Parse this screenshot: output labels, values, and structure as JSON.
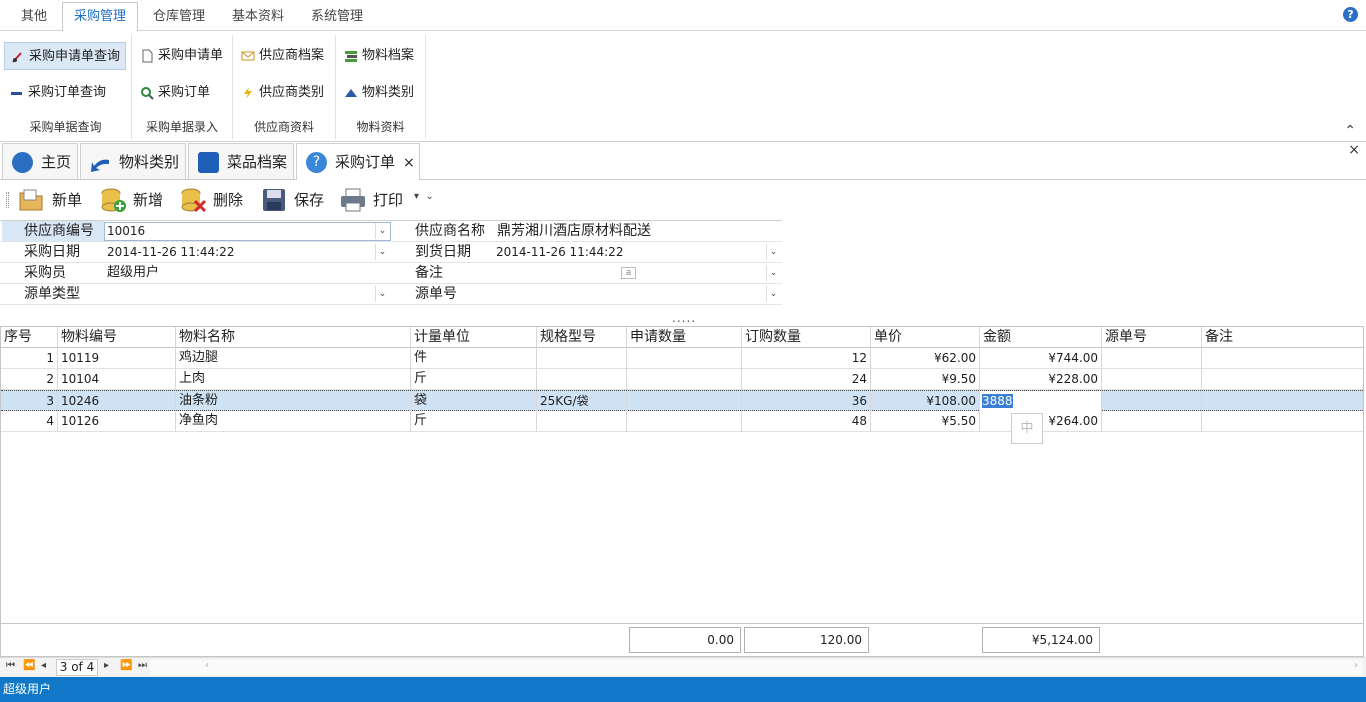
{
  "ribbon_tabs": [
    "其他",
    "采购管理",
    "仓库管理",
    "基本资料",
    "系统管理"
  ],
  "help_icon": "help-icon",
  "ribbon_groups": {
    "query": {
      "caption": "采购单据查询",
      "btn1": "采购申请单查询",
      "btn2": "采购订单查询"
    },
    "entry": {
      "caption": "采购单据录入",
      "btn1": "采购申请单",
      "btn2": "采购订单"
    },
    "supplier": {
      "caption": "供应商资料",
      "btn1": "供应商档案",
      "btn2": "供应商类别"
    },
    "material": {
      "caption": "物料资料",
      "btn1": "物料档案",
      "btn2": "物料类别"
    }
  },
  "doc_tabs": [
    "主页",
    "物料类别",
    "菜品档案",
    "采购订单"
  ],
  "toolbar": {
    "new_doc": "新单",
    "add": "新增",
    "delete": "删除",
    "save": "保存",
    "print": "打印"
  },
  "form": {
    "supplier_code_label": "供应商编号",
    "supplier_code": "10016",
    "supplier_name_label": "供应商名称",
    "supplier_name": "鼎芳湘川酒店原材料配送",
    "purchase_date_label": "采购日期",
    "purchase_date": "2014-11-26 11:44:22",
    "arrival_date_label": "到货日期",
    "arrival_date": "2014-11-26 11:44:22",
    "buyer_label": "采购员",
    "buyer": "超级用户",
    "remark_label": "备注",
    "remark": "",
    "source_type_label": "源单类型",
    "source_type": "",
    "source_no_label": "源单号",
    "source_no": ""
  },
  "splitter": ".....",
  "grid": {
    "columns": [
      "序号",
      "物料编号",
      "物料名称",
      "计量单位",
      "规格型号",
      "申请数量",
      "订购数量",
      "单价",
      "金额",
      "源单号",
      "备注"
    ],
    "rows": [
      {
        "no": "1",
        "code": "10119",
        "name": "鸡边腿",
        "unit": "件",
        "spec": "",
        "req": "",
        "qty": "12",
        "price": "¥62.00",
        "amount": "¥744.00",
        "src": "",
        "remark": ""
      },
      {
        "no": "2",
        "code": "10104",
        "name": "上肉",
        "unit": "斤",
        "spec": "",
        "req": "",
        "qty": "24",
        "price": "¥9.50",
        "amount": "¥228.00",
        "src": "",
        "remark": ""
      },
      {
        "no": "3",
        "code": "10246",
        "name": "油条粉",
        "unit": "袋",
        "spec": "25KG/袋",
        "req": "",
        "qty": "36",
        "price": "¥108.00",
        "amount": "3888",
        "src": "",
        "remark": ""
      },
      {
        "no": "4",
        "code": "10126",
        "name": "净鱼肉",
        "unit": "斤",
        "spec": "",
        "req": "",
        "qty": "48",
        "price": "¥5.50",
        "amount": "¥264.00",
        "src": "",
        "remark": ""
      }
    ]
  },
  "ime_indicator": "中",
  "totals": {
    "req_total": "0.00",
    "qty_total": "120.00",
    "amount_total": "¥5,124.00"
  },
  "pager": {
    "position": "3 of 4"
  },
  "status": {
    "user": "超级用户"
  },
  "colors": {
    "accent": "#1c6fc7",
    "status_bar": "#1177c7",
    "selection": "#cfe3f5"
  }
}
